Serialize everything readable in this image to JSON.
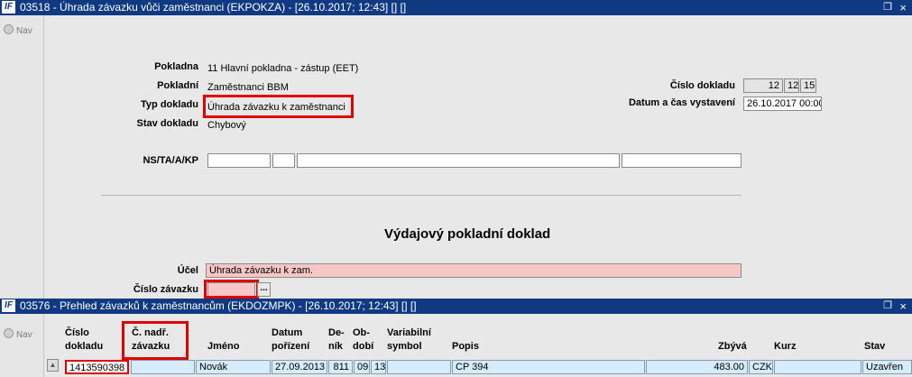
{
  "window1": {
    "title": "03518 - Úhrada závazku vůči zaměstnanci (EKPOKZA) - [26.10.2017; 12:43] [] []",
    "restore_icon": "restore-icon",
    "close_icon": "close-icon"
  },
  "nav_label": "Nav",
  "form": {
    "pokladna_label": "Pokladna",
    "pokladna_value": "11 Hlavní pokladna - zástup (EET)",
    "pokladni_label": "Pokladní",
    "pokladni_value": "Zaměstnanci BBM",
    "typ_label": "Typ dokladu",
    "typ_value": "Úhrada závazku k zaměstnanci",
    "stav_label": "Stav dokladu",
    "stav_value": "Chybový",
    "cislo_dokladu_label": "Číslo dokladu",
    "cislo_parts": [
      "12",
      "12",
      "15"
    ],
    "datum_label": "Datum a čas vystavení",
    "datum_value": "26.10.2017 00:00",
    "ns_label": "NS/TA/A/KP",
    "section_heading": "Výdajový pokladní doklad",
    "ucel_label": "Účel",
    "ucel_value": "Úhrada závazku k zam.",
    "cislo_zavazku_label": "Číslo závazku",
    "lookup_button": "..."
  },
  "window2": {
    "title": "03576 - Přehled závazků k zaměstnancům (EKDOZMPK) - [26.10.2017; 12:43] [] []"
  },
  "table": {
    "headers": {
      "cislo_dokladu": [
        "Číslo",
        "dokladu"
      ],
      "c_nadr_zavazku": [
        "Č. nadř.",
        "závazku"
      ],
      "jmeno": "Jméno",
      "datum_porizeni": [
        "Datum",
        "pořízení"
      ],
      "denik": [
        "De-",
        "ník"
      ],
      "obdobi": [
        "Ob-",
        "dobí"
      ],
      "variabilni_symbol": [
        "Variabilní",
        "symbol"
      ],
      "popis": "Popis",
      "zbyva": "Zbývá",
      "kurz": "Kurz",
      "stav": "Stav"
    },
    "rows": [
      {
        "cislo_dokladu": "1413590398",
        "c_nadr_zavazku": "",
        "jmeno": "Novák",
        "datum_porizeni": "27.09.2013",
        "denik": "811",
        "obdobi_a": "09",
        "obdobi_b": "13",
        "variabilni_symbol": "",
        "popis": "CP 394",
        "zbyva": "483.00",
        "mena": "CZK",
        "kurz": "",
        "stav": "Uzavřen"
      }
    ]
  },
  "colors": {
    "titlebar": "#0f3a82",
    "highlight": "#e00000",
    "required_field": "#f7c6c6",
    "grid_cell": "#d6ecfb"
  }
}
